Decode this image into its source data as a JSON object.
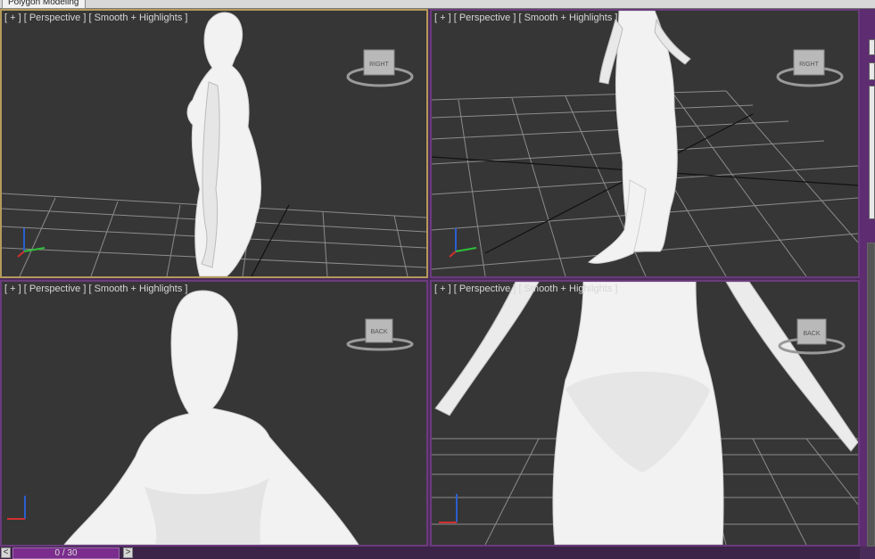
{
  "ribbon": {
    "active_tab": "Polygon Modeling"
  },
  "viewports": [
    {
      "label": "[ + ] [ Perspective ] [ Smooth + Highlights ]",
      "cube_face": "RIGHT",
      "active": true
    },
    {
      "label": "[ + ] [ Perspective ] [ Smooth + Highlights ]",
      "cube_face": "RIGHT",
      "active": false
    },
    {
      "label": "[ + ] [ Perspective ] [ Smooth + Highlights ]",
      "cube_face": "BACK",
      "active": false
    },
    {
      "label": "[ + ] [ Perspective ] [ Smooth + Highlights ]",
      "cube_face": "BACK",
      "active": false
    }
  ],
  "time_slider": {
    "prev": "<",
    "frame": "0 / 30",
    "next": ">"
  },
  "colors": {
    "viewport_bg": "#363636",
    "active_border": "#b59a5a",
    "frame_bg": "#4a2c5a",
    "grid": "#8c8c8c",
    "model": "#f2f2f2"
  }
}
